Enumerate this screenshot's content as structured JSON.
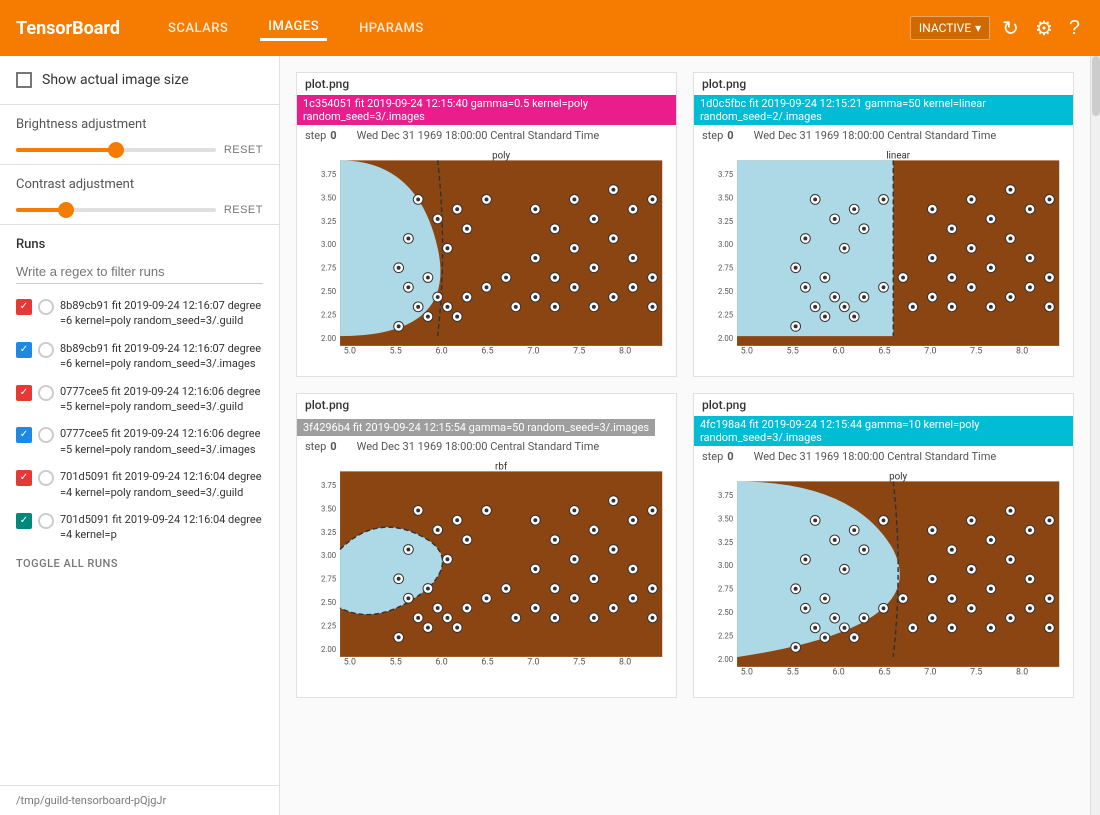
{
  "brand": "TensorBoard",
  "nav": {
    "items": [
      "SCALARS",
      "IMAGES",
      "HPARAMS"
    ],
    "active": "IMAGES"
  },
  "run_selector": {
    "label": "INACTIVE",
    "dropdown_icon": "▾"
  },
  "sidebar": {
    "show_actual_size_label": "Show actual image size",
    "brightness_label": "Brightness adjustment",
    "brightness_reset": "RESET",
    "brightness_value": 50,
    "contrast_label": "Contrast adjustment",
    "contrast_reset": "RESET",
    "contrast_value": 25,
    "runs_label": "Runs",
    "runs_filter_placeholder": "Write a regex to filter runs",
    "run_items": [
      {
        "text": "8b89cb91 fit 2019-09-24 12:16:07 degree=6 kernel=poly random_seed=3/.guild",
        "checked": true,
        "color": "#e53935"
      },
      {
        "text": "8b89cb91 fit 2019-09-24 12:16:07 degree=6 kernel=poly random_seed=3/.images",
        "checked": true,
        "color": "#1e88e5"
      },
      {
        "text": "0777cee5 fit 2019-09-24 12:16:06 degree=5 kernel=poly random_seed=3/.guild",
        "checked": true,
        "color": "#e53935"
      },
      {
        "text": "0777cee5 fit 2019-09-24 12:16:06 degree=5 kernel=poly random_seed=3/.images",
        "checked": true,
        "color": "#1e88e5"
      },
      {
        "text": "701d5091 fit 2019-09-24 12:16:04 degree=4 kernel=poly random_seed=3/.guild",
        "checked": true,
        "color": "#e53935"
      },
      {
        "text": "701d5091 fit 2019-09-24 12:16:04 degree=4 kernel=p",
        "checked": true,
        "color": "#00897b"
      }
    ],
    "toggle_all": "TOGGLE ALL RUNS",
    "footer": "/tmp/guild-tensorboard-pQjgJr"
  },
  "plots": [
    {
      "title": "plot.png",
      "run_tag": "1c354051 fit 2019-09-24 12:15:40 gamma=0.5 kernel=poly random_seed=3/.images",
      "run_tag_color": "#e91e8c",
      "step_label": "step",
      "step_value": "0",
      "timestamp": "Wed Dec 31 1969 18:00:00 Central Standard Time",
      "chart_title": "poly",
      "chart_type": "poly"
    },
    {
      "title": "plot.png",
      "run_tag": "1d0c5fbc fit 2019-09-24 12:15:21 gamma=50 kernel=linear random_seed=2/.images",
      "run_tag_color": "#00bcd4",
      "step_label": "step",
      "step_value": "0",
      "timestamp": "Wed Dec 31 1969 18:00:00 Central Standard Time",
      "chart_title": "linear",
      "chart_type": "linear"
    },
    {
      "title": "plot.png",
      "run_tag": "3f4296b4 fit 2019-09-24 12:15:54 gamma=50 random_seed=3/.images",
      "run_tag_color": "#9e9e9e",
      "step_label": "step",
      "step_value": "0",
      "timestamp": "Wed Dec 31 1969 18:00:00 Central Standard Time",
      "chart_title": "rbf",
      "chart_type": "rbf"
    },
    {
      "title": "plot.png",
      "run_tag": "4fc198a4 fit 2019-09-24 12:15:44 gamma=10 kernel=poly random_seed=3/.images",
      "run_tag_color": "#00bcd4",
      "step_label": "step",
      "step_value": "0",
      "timestamp": "Wed Dec 31 1969 18:00:00 Central Standard Time",
      "chart_title": "poly",
      "chart_type": "poly2"
    }
  ]
}
